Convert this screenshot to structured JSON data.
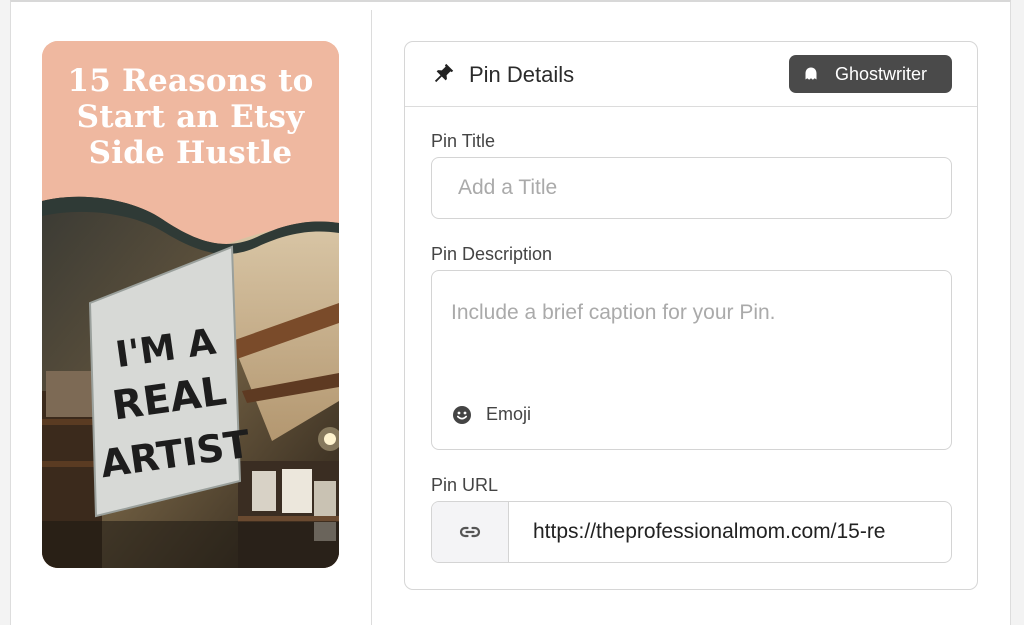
{
  "pin_preview": {
    "headline_lines": [
      "15 Reasons to",
      "Start an Etsy",
      "Side Hustle"
    ],
    "sign_text_lines": [
      "I'M A",
      "REAL",
      "ARTIST"
    ],
    "background_color": "#efb8a0"
  },
  "panel": {
    "title": "Pin Details",
    "title_icon": "pushpin-icon",
    "ghostwriter_button": {
      "label": "Ghostwriter",
      "icon": "ghost-icon"
    }
  },
  "form": {
    "title": {
      "label": "Pin Title",
      "value": "",
      "placeholder": "Add a Title"
    },
    "description": {
      "label": "Pin Description",
      "value": "",
      "placeholder": "Include a brief caption for your Pin.",
      "emoji_label": "Emoji"
    },
    "url": {
      "label": "Pin URL",
      "value": "https://theprofessionalmom.com/15-re",
      "icon": "link-icon"
    }
  },
  "colors": {
    "button_bg": "#4a4a4a",
    "border": "#d4d4d4",
    "pin_peach": "#efb8a0"
  }
}
